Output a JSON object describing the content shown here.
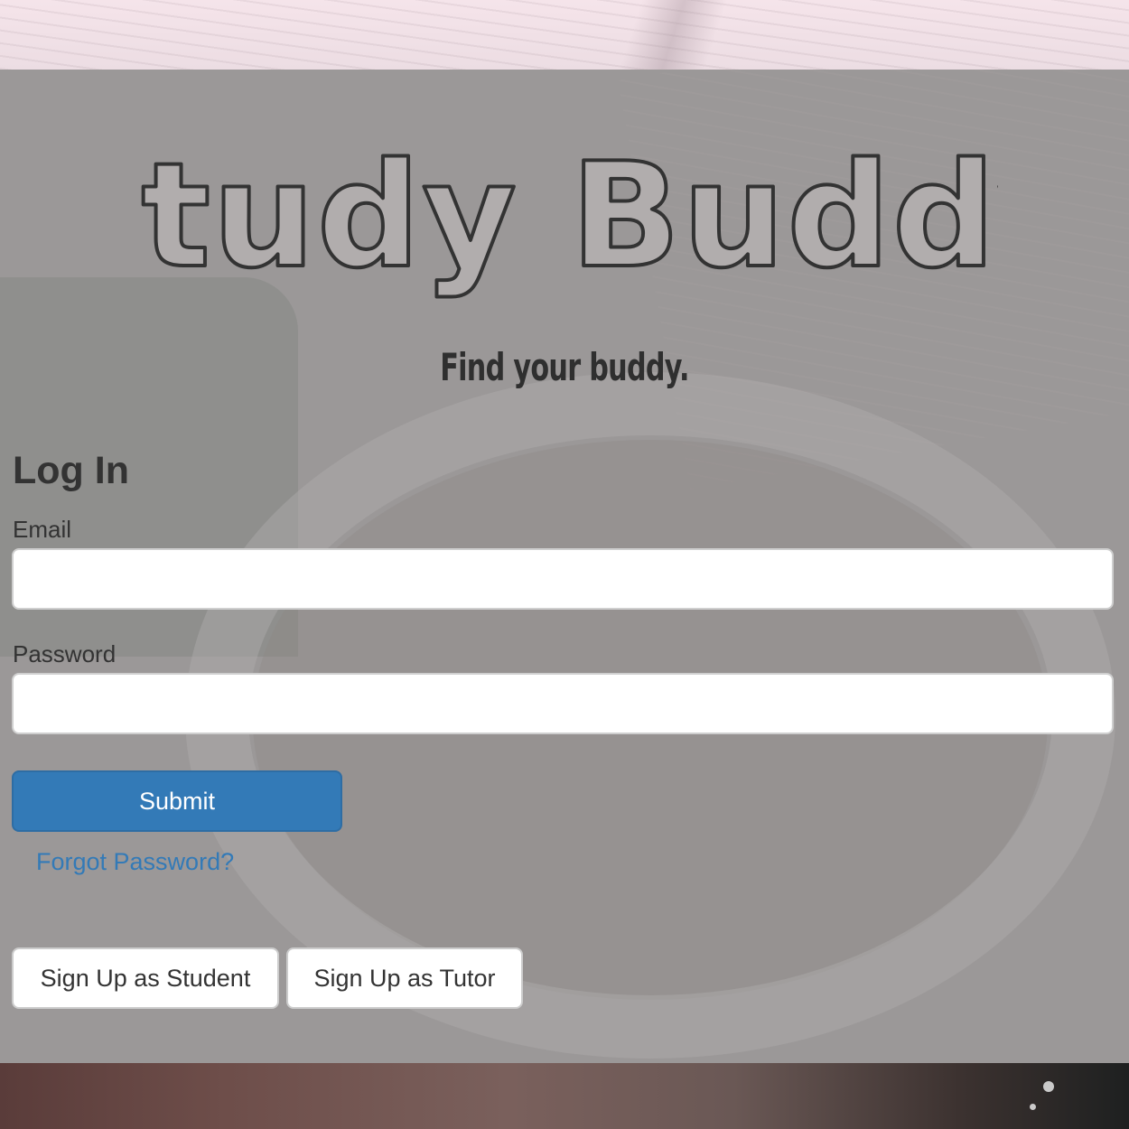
{
  "header": {
    "logo_text": "Study Buddy",
    "tagline": "Find your buddy."
  },
  "login": {
    "title": "Log In",
    "email_label": "Email",
    "email_value": "",
    "password_label": "Password",
    "password_value": "",
    "submit_label": "Submit",
    "forgot_label": "Forgot Password?"
  },
  "signup": {
    "student_label": "Sign Up as Student",
    "tutor_label": "Sign Up as Tutor"
  },
  "colors": {
    "primary": "#337ab7",
    "overlay": "#9b9898",
    "text": "#333333"
  }
}
